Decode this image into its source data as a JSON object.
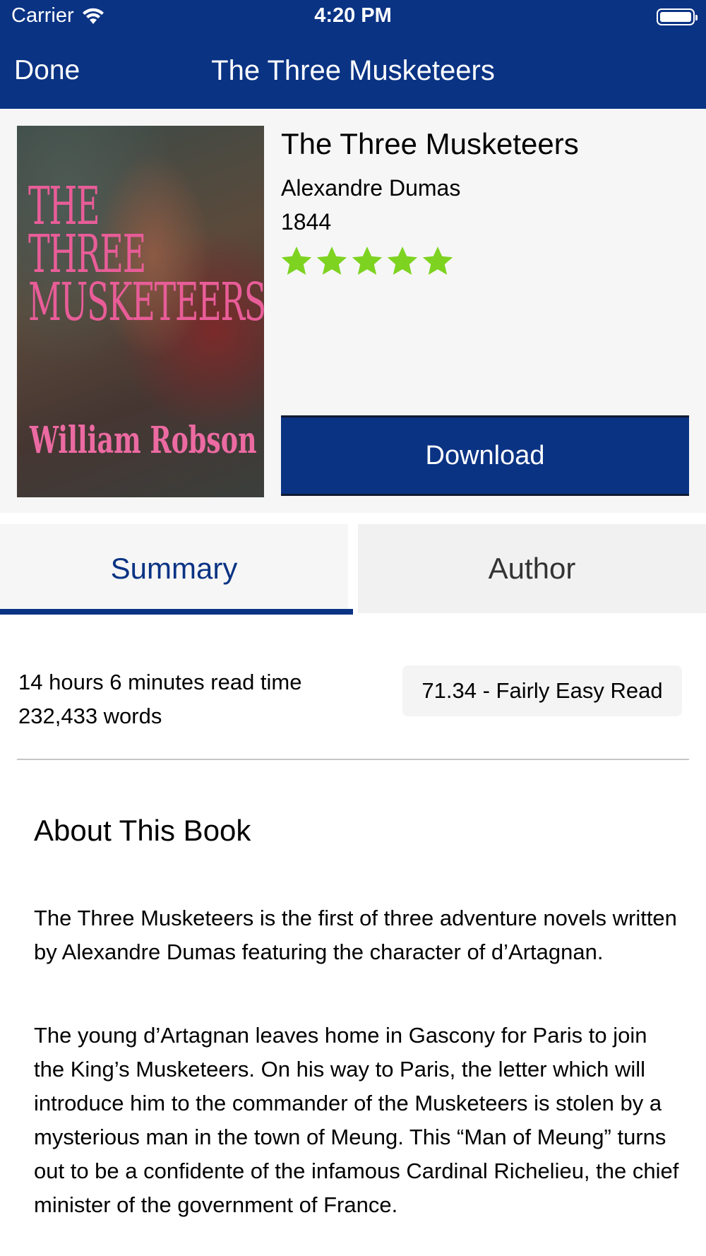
{
  "status_bar": {
    "carrier": "Carrier",
    "time": "4:20 PM"
  },
  "nav": {
    "done_label": "Done",
    "title": "The Three Musketeers"
  },
  "cover": {
    "title_lines": [
      "THE",
      "THREE",
      "MUSKETEERS"
    ],
    "author": "William Robson"
  },
  "book": {
    "title": "The Three Musketeers",
    "author": "Alexandre Dumas",
    "year": "1844",
    "rating": 5,
    "rating_color": "#7ed321",
    "download_label": "Download"
  },
  "tabs": [
    {
      "label": "Summary",
      "selected": true
    },
    {
      "label": "Author",
      "selected": false
    }
  ],
  "summary": {
    "read_time": "14 hours 6 minutes read time",
    "word_count": "232,433 words",
    "readability": "71.34 - Fairly Easy Read",
    "about_heading": "About This Book",
    "paragraphs": [
      "The Three Musketeers is the first of three adventure novels written by Alexandre Dumas featuring the character of d’Artagnan.",
      "The young d’Artagnan leaves home in Gascony for Paris to join the King’s Musketeers. On his way to Paris, the letter which will introduce him to the commander of the Musketeers is stolen by a mysterious man in the town of Meung. This “Man of Meung” turns out to be a confidente of the infamous Cardinal Richelieu, the chief minister of the government of France."
    ]
  },
  "colors": {
    "brand": "#0a3384",
    "star": "#7ed321",
    "header_bg": "#f6f6f6"
  },
  "icons": [
    "wifi-icon",
    "battery-icon",
    "star-icon"
  ]
}
